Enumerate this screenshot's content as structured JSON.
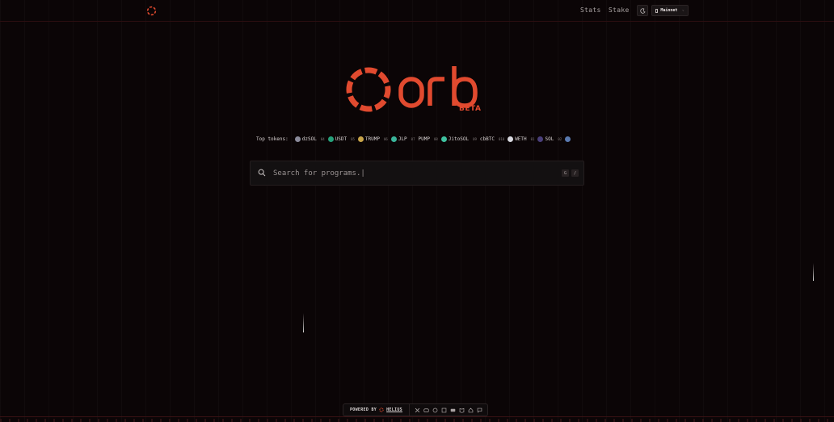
{
  "nav": {
    "stats": "Stats",
    "stake": "Stake",
    "network": "Mainnet"
  },
  "brand": {
    "name": "orb",
    "badge": "BETA",
    "accent": "#e14a2f"
  },
  "tokens": {
    "label": "Top tokens:",
    "items": [
      {
        "rank": "",
        "name": "dzSOL",
        "color": "#8a8a9a"
      },
      {
        "rank": "04",
        "name": "USDT",
        "color": "#26a17b"
      },
      {
        "rank": "05",
        "name": "TRUMP",
        "color": "#c9a54a"
      },
      {
        "rank": "06",
        "name": "JLP",
        "color": "#3ab49a"
      },
      {
        "rank": "07",
        "name": "PUMP",
        "color": "#6fd48a"
      },
      {
        "rank": "08",
        "name": "JitoSOL",
        "color": "#3fc1a0"
      },
      {
        "rank": "09",
        "name": "cbBTC",
        "color": "#2b5bd7"
      },
      {
        "rank": "010",
        "name": "WETH",
        "color": "#d9d9e0"
      },
      {
        "rank": "01",
        "name": "SOL",
        "color": "#9945ff"
      },
      {
        "rank": "02",
        "name": "",
        "color": "#5a7ab0"
      }
    ]
  },
  "search": {
    "placeholder": "Search for programs.|",
    "shortcut_1": "G",
    "shortcut_2": "/"
  },
  "footer": {
    "powered_by": "POWERED BY",
    "provider": "HELIUS",
    "social_icons": [
      "x-icon",
      "discord-icon",
      "github-icon",
      "docs-icon",
      "youtube-icon",
      "book-icon",
      "home-icon",
      "chat-icon"
    ]
  }
}
